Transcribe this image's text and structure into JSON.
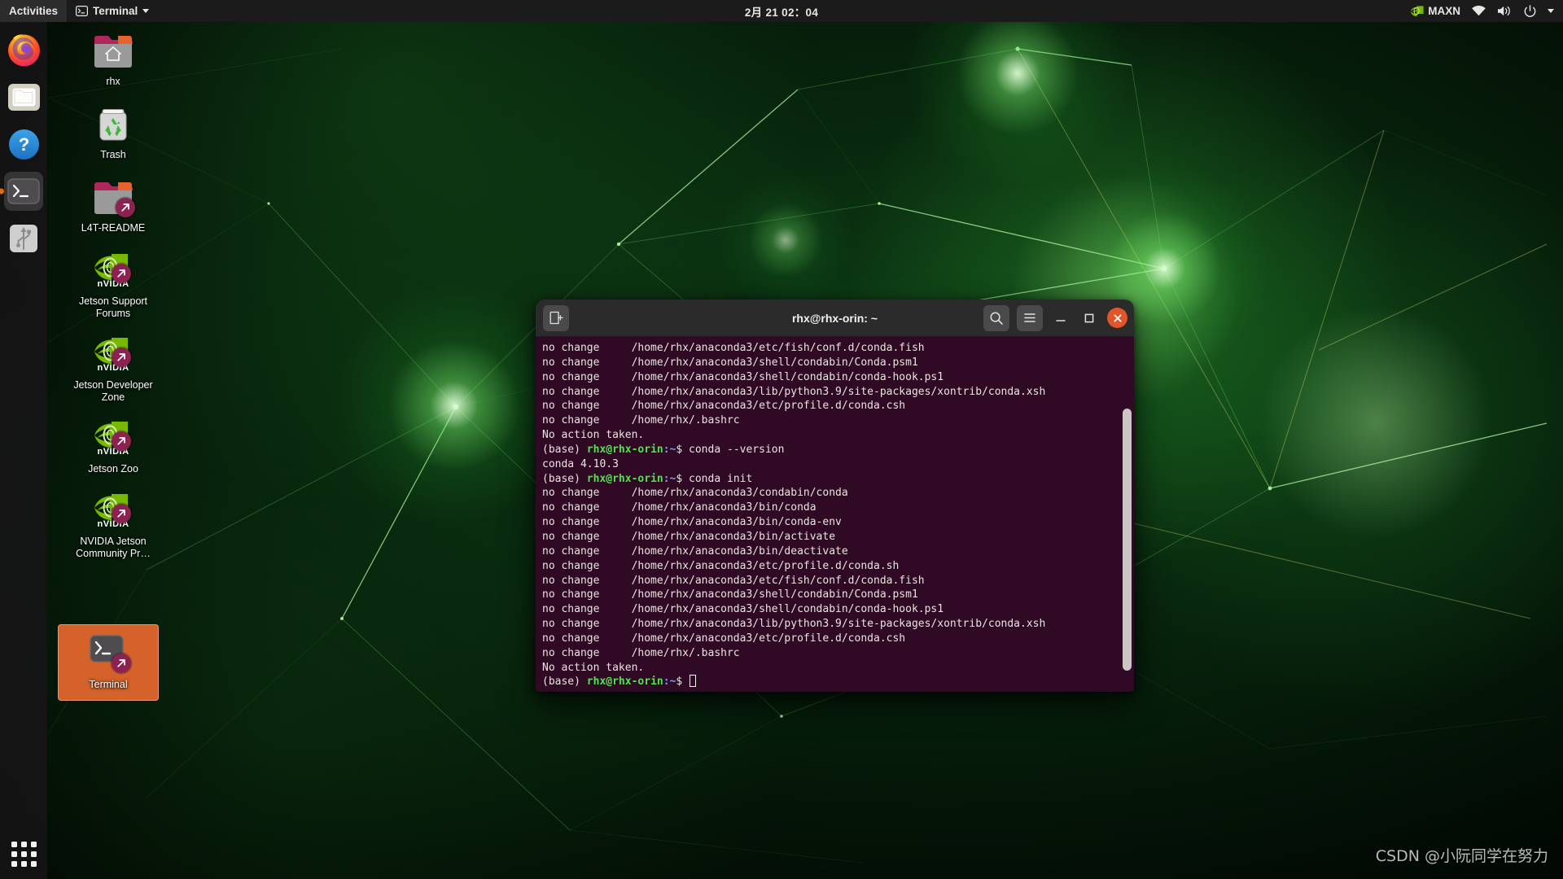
{
  "topbar": {
    "activities": "Activities",
    "app_menu": "Terminal",
    "app_menu_icon": "terminal-icon",
    "clock": "2月 21 02：04",
    "power_mode": "MAXN",
    "power_mode_icon": "nvidia-icon",
    "status_icons": [
      "wifi-icon",
      "volume-icon",
      "power-icon",
      "chevron-down-icon"
    ],
    "accent": "#1b1b1b"
  },
  "dock": {
    "items": [
      {
        "name": "firefox",
        "tooltip": "Firefox",
        "icon": "firefox-icon",
        "active": false
      },
      {
        "name": "files",
        "tooltip": "Files",
        "icon": "folder-icon",
        "active": false
      },
      {
        "name": "help",
        "tooltip": "Help",
        "icon": "question-mark-icon",
        "active": false
      },
      {
        "name": "terminal",
        "tooltip": "Terminal",
        "icon": "terminal-icon",
        "active": true
      },
      {
        "name": "usb-drive",
        "tooltip": "USB Drive",
        "icon": "usb-icon",
        "active": false
      }
    ],
    "show_applications": "Show Applications",
    "running_dot_color": "#e8690f"
  },
  "desktop_icons": [
    {
      "label": "rhx",
      "icon": "home-folder-icon",
      "type": "folder",
      "link": false,
      "selected": false
    },
    {
      "label": "Trash",
      "icon": "trash-icon",
      "type": "trash",
      "link": false,
      "selected": false
    },
    {
      "label": "L4T-README",
      "icon": "folder-icon",
      "type": "folder",
      "link": true,
      "selected": false
    },
    {
      "label": "Jetson Support Forums",
      "icon": "nvidia-icon",
      "type": "link",
      "link": true,
      "selected": false
    },
    {
      "label": "Jetson Developer Zone",
      "icon": "nvidia-icon",
      "type": "link",
      "link": true,
      "selected": false
    },
    {
      "label": "Jetson Zoo",
      "icon": "nvidia-icon",
      "type": "link",
      "link": true,
      "selected": false
    },
    {
      "label": "NVIDIA Jetson Community Pr…",
      "icon": "nvidia-icon",
      "type": "link",
      "link": true,
      "selected": false
    },
    {
      "label": "Terminal",
      "icon": "terminal-icon",
      "type": "link",
      "link": true,
      "selected": true
    }
  ],
  "terminal": {
    "title": "rhx@rhx-orin: ~",
    "new_tab_label": "New Tab",
    "search_label": "Search",
    "menu_label": "Menu",
    "minimize_label": "Minimize",
    "maximize_label": "Maximize",
    "close_label": "Close",
    "background": "#300a24",
    "prompt_user_color": "#4ee44e",
    "prompt_path_color": "#6ea0ff",
    "lines": [
      {
        "type": "out",
        "text": "no change     /home/rhx/anaconda3/etc/fish/conf.d/conda.fish"
      },
      {
        "type": "out",
        "text": "no change     /home/rhx/anaconda3/shell/condabin/Conda.psm1"
      },
      {
        "type": "out",
        "text": "no change     /home/rhx/anaconda3/shell/condabin/conda-hook.ps1"
      },
      {
        "type": "out",
        "text": "no change     /home/rhx/anaconda3/lib/python3.9/site-packages/xontrib/conda.xsh"
      },
      {
        "type": "out",
        "text": "no change     /home/rhx/anaconda3/etc/profile.d/conda.csh"
      },
      {
        "type": "out",
        "text": "no change     /home/rhx/.bashrc"
      },
      {
        "type": "out",
        "text": "No action taken."
      },
      {
        "type": "prompt",
        "env": "(base) ",
        "user": "rhx@rhx-orin",
        "path": ":~",
        "sym": "$ ",
        "cmd": "conda --version"
      },
      {
        "type": "out",
        "text": "conda 4.10.3"
      },
      {
        "type": "prompt",
        "env": "(base) ",
        "user": "rhx@rhx-orin",
        "path": ":~",
        "sym": "$ ",
        "cmd": "conda init"
      },
      {
        "type": "out",
        "text": "no change     /home/rhx/anaconda3/condabin/conda"
      },
      {
        "type": "out",
        "text": "no change     /home/rhx/anaconda3/bin/conda"
      },
      {
        "type": "out",
        "text": "no change     /home/rhx/anaconda3/bin/conda-env"
      },
      {
        "type": "out",
        "text": "no change     /home/rhx/anaconda3/bin/activate"
      },
      {
        "type": "out",
        "text": "no change     /home/rhx/anaconda3/bin/deactivate"
      },
      {
        "type": "out",
        "text": "no change     /home/rhx/anaconda3/etc/profile.d/conda.sh"
      },
      {
        "type": "out",
        "text": "no change     /home/rhx/anaconda3/etc/fish/conf.d/conda.fish"
      },
      {
        "type": "out",
        "text": "no change     /home/rhx/anaconda3/shell/condabin/Conda.psm1"
      },
      {
        "type": "out",
        "text": "no change     /home/rhx/anaconda3/shell/condabin/conda-hook.ps1"
      },
      {
        "type": "out",
        "text": "no change     /home/rhx/anaconda3/lib/python3.9/site-packages/xontrib/conda.xsh"
      },
      {
        "type": "out",
        "text": "no change     /home/rhx/anaconda3/etc/profile.d/conda.csh"
      },
      {
        "type": "out",
        "text": "no change     /home/rhx/.bashrc"
      },
      {
        "type": "out",
        "text": "No action taken."
      },
      {
        "type": "prompt",
        "env": "(base) ",
        "user": "rhx@rhx-orin",
        "path": ":~",
        "sym": "$ ",
        "cmd": "",
        "cursor": true
      }
    ]
  },
  "watermark": "CSDN @小阮同学在努力"
}
